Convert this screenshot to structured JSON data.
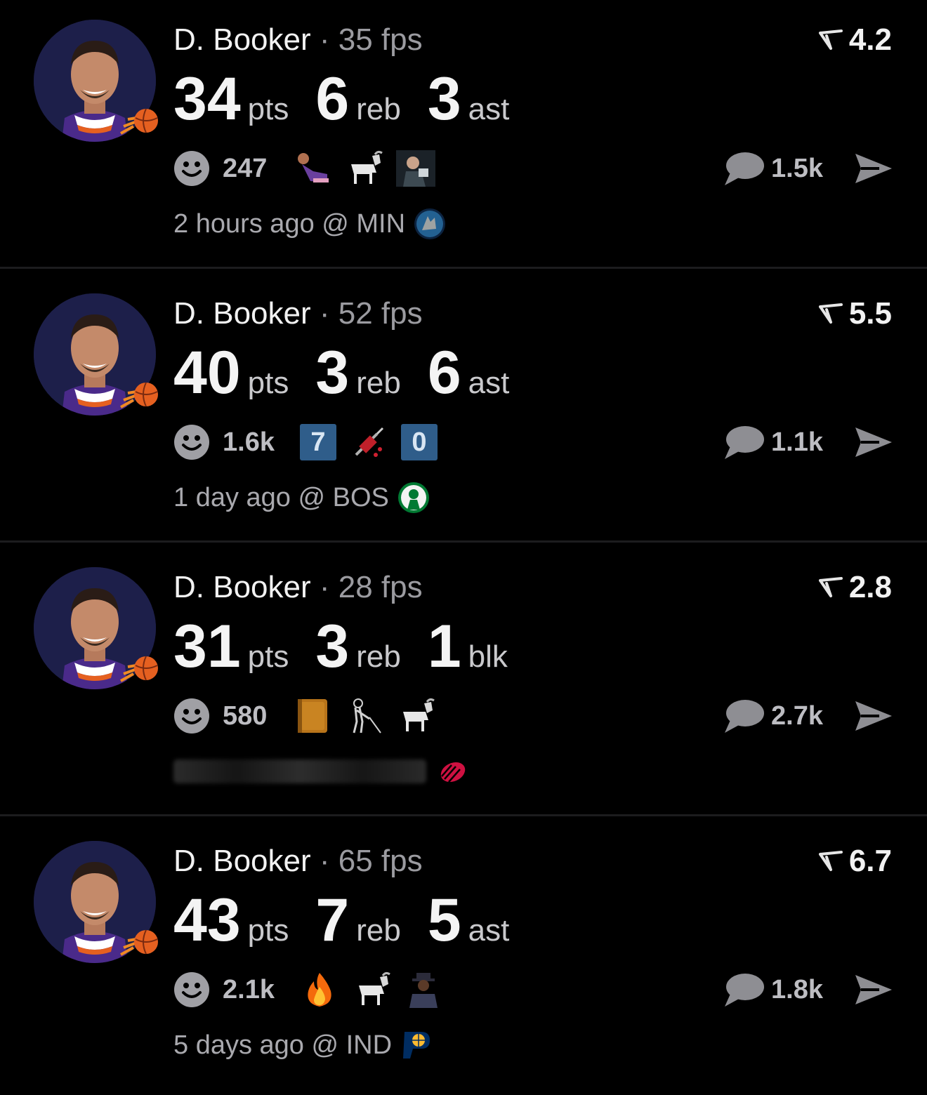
{
  "posts": [
    {
      "player": "D. Booker",
      "dot": "·",
      "fps": "35 fps",
      "rating": "4.2",
      "stats": [
        {
          "value": "34",
          "unit": "pts"
        },
        {
          "value": "6",
          "unit": "reb"
        },
        {
          "value": "3",
          "unit": "ast"
        }
      ],
      "reaction_count": "247",
      "comment_count": "1.5k",
      "time_ago": "2 hours ago @ MIN",
      "reactions": [
        "player-lying-emoji",
        "goat-emoji",
        "man-reading-emoji"
      ]
    },
    {
      "player": "D. Booker",
      "dot": "·",
      "fps": "52 fps",
      "rating": "5.5",
      "stats": [
        {
          "value": "40",
          "unit": "pts"
        },
        {
          "value": "3",
          "unit": "reb"
        },
        {
          "value": "6",
          "unit": "ast"
        }
      ],
      "reaction_count": "1.6k",
      "comment_count": "1.1k",
      "time_ago": "1 day ago @ BOS",
      "badges": [
        "7",
        "0"
      ],
      "reactions": [
        "keycap-7",
        "syringe-emoji",
        "keycap-0"
      ]
    },
    {
      "player": "D. Booker",
      "dot": "·",
      "fps": "28 fps",
      "rating": "2.8",
      "stats": [
        {
          "value": "31",
          "unit": "pts"
        },
        {
          "value": "3",
          "unit": "reb"
        },
        {
          "value": "1",
          "unit": "blk"
        }
      ],
      "reaction_count": "580",
      "comment_count": "2.7k",
      "reactions": [
        "book-emoji",
        "old-man-cane-emoji",
        "goat-emoji"
      ]
    },
    {
      "player": "D. Booker",
      "dot": "·",
      "fps": "65 fps",
      "rating": "6.7",
      "stats": [
        {
          "value": "43",
          "unit": "pts"
        },
        {
          "value": "7",
          "unit": "reb"
        },
        {
          "value": "5",
          "unit": "ast"
        }
      ],
      "reaction_count": "2.1k",
      "comment_count": "1.8k",
      "time_ago": "5 days ago @ IND",
      "reactions": [
        "fire-emoji",
        "goat-emoji",
        "man-hat-emoji"
      ]
    }
  ],
  "colors": {
    "background": "#000000",
    "divider": "#1c1c1e",
    "muted_text": "#a9a9ae",
    "badge": "#2f5d8a",
    "suns_orange": "#e56020",
    "suns_purple": "#1d1160"
  }
}
